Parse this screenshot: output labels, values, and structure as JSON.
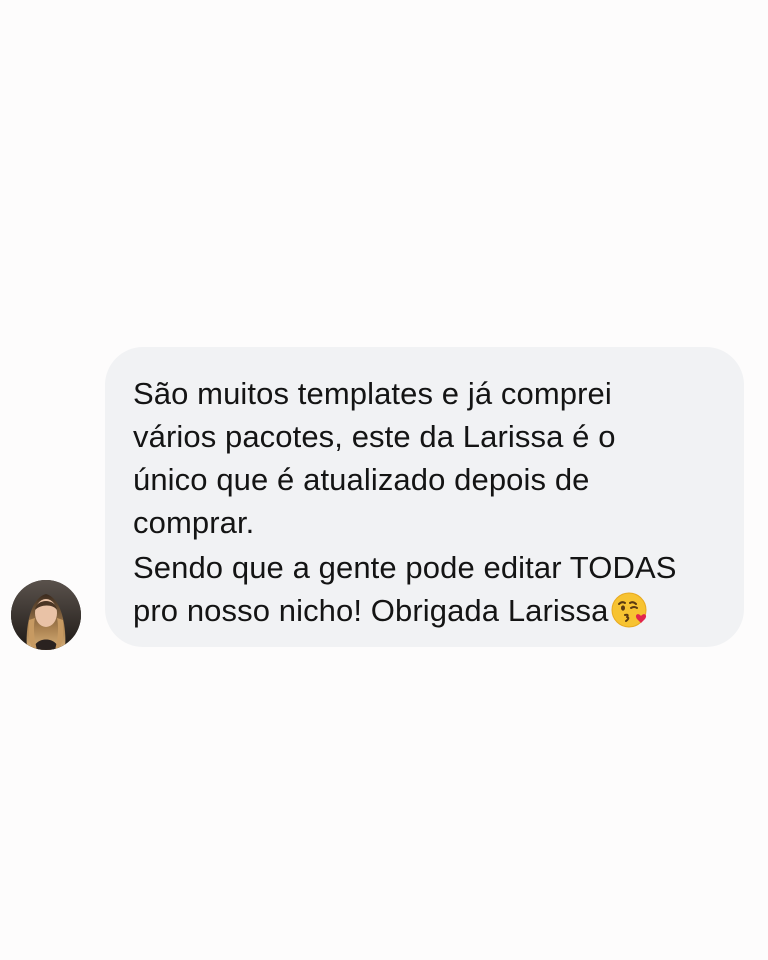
{
  "message": {
    "lines": [
      "São muitos templates e já comprei",
      "vários pacotes, este da Larissa é o",
      "único que é atualizado depois de",
      "comprar.",
      "Sendo que a gente pode editar TODAS",
      "pro nosso nicho! Obrigada Larissa"
    ],
    "emoji": "kissing-face-with-heart-emoji"
  },
  "sender": {
    "avatar": "profile-photo"
  },
  "colors": {
    "background": "#fdfcfc",
    "bubble": "#f1f2f4",
    "text": "#141414",
    "emoji_face": "#f7c331",
    "emoji_heart": "#e2264d"
  }
}
